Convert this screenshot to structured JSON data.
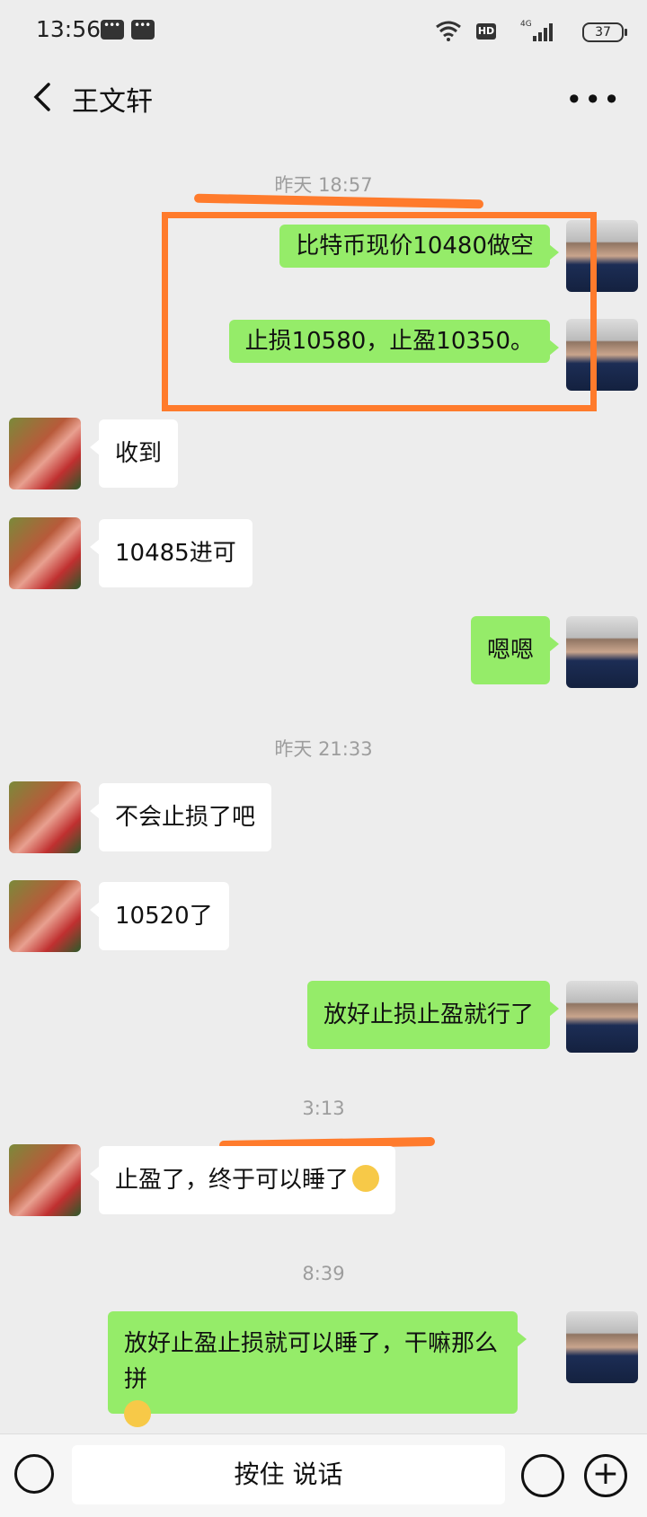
{
  "status": {
    "time": "13:56",
    "net": "4G",
    "battery": "37"
  },
  "nav": {
    "title": "王文轩"
  },
  "timestamps": [
    "昨天 18:57",
    "昨天 21:33",
    "3:13",
    "8:39"
  ],
  "messages": [
    "比特币现价10480做空",
    "止损10580，止盈10350。",
    "收到",
    "10485进可",
    "嗯嗯",
    "不会止损了吧",
    "10520了",
    "放好止损止盈就行了",
    "止盈了，终于可以睡了",
    "放好止盈止损就可以睡了，干嘛那么拼"
  ],
  "input": {
    "talk_label": "按住 说话"
  },
  "colors": {
    "me_bubble": "#95ec69",
    "other_bubble": "#ffffff",
    "annotation": "#ff7b2c",
    "background": "#ededed"
  },
  "icons": {
    "back": "chevron-left-icon",
    "more": "more-dots-icon",
    "keyboard": "keyboard-icon",
    "emoji": "emoji-icon",
    "plus": "plus-icon"
  }
}
